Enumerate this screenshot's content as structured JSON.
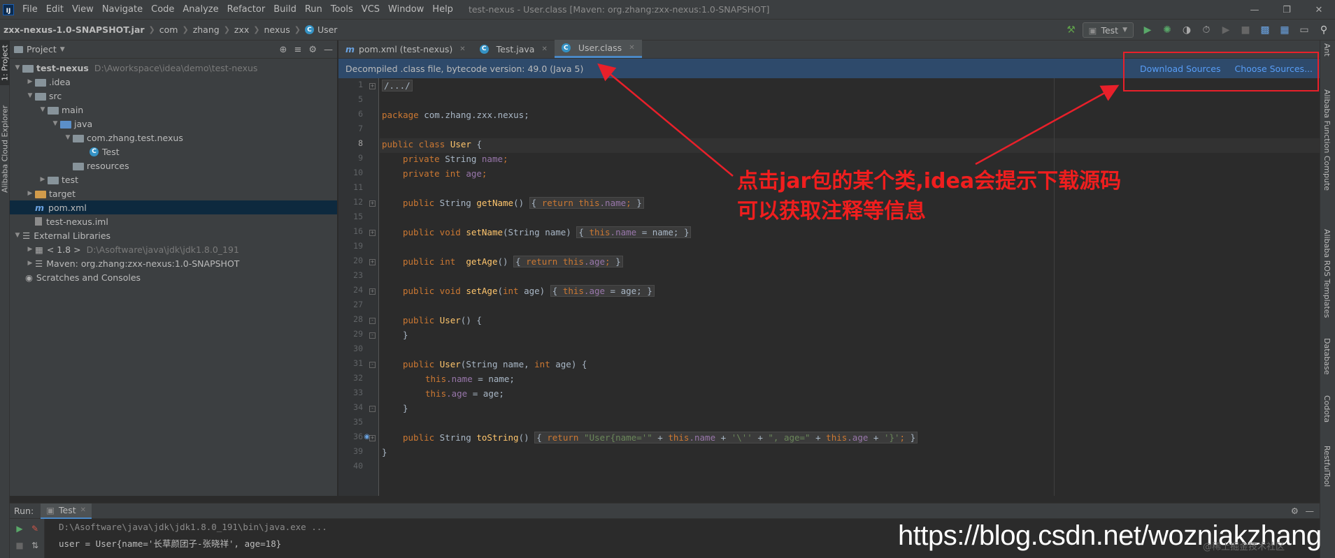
{
  "menubar": {
    "logo": "IJ",
    "items": [
      "File",
      "Edit",
      "View",
      "Navigate",
      "Code",
      "Analyze",
      "Refactor",
      "Build",
      "Run",
      "Tools",
      "VCS",
      "Window",
      "Help"
    ],
    "window_title": "test-nexus - User.class [Maven: org.zhang:zxx-nexus:1.0-SNAPSHOT]"
  },
  "navbar": {
    "breadcrumb": [
      "zxx-nexus-1.0-SNAPSHOT.jar",
      "com",
      "zhang",
      "zxx",
      "nexus",
      "User"
    ],
    "run_config": "Test"
  },
  "left_stripe": {
    "tabs": [
      "1: Project",
      "Alibaba Cloud Explorer"
    ]
  },
  "right_stripe": {
    "tabs": [
      "Ant",
      "Alibaba Function Compute",
      "Alibaba ROS Templates",
      "Database",
      "Codota",
      "RestfulTool"
    ]
  },
  "project_panel": {
    "title": "Project",
    "tree": [
      {
        "label": "test-nexus",
        "path": "D:\\Aworkspace\\idea\\demo\\test-nexus"
      },
      {
        "label": ".idea"
      },
      {
        "label": "src"
      },
      {
        "label": "main"
      },
      {
        "label": "java"
      },
      {
        "label": "com.zhang.test.nexus"
      },
      {
        "label": "Test"
      },
      {
        "label": "resources"
      },
      {
        "label": "test"
      },
      {
        "label": "target"
      },
      {
        "label": "pom.xml"
      },
      {
        "label": "test-nexus.iml"
      },
      {
        "label": "External Libraries"
      },
      {
        "label": "< 1.8 >",
        "path": "D:\\Asoftware\\java\\jdk\\jdk1.8.0_191"
      },
      {
        "label": "Maven: org.zhang:zxx-nexus:1.0-SNAPSHOT"
      },
      {
        "label": "Scratches and Consoles"
      }
    ]
  },
  "editor": {
    "tabs": [
      {
        "label": "pom.xml (test-nexus)",
        "icon": "m"
      },
      {
        "label": "Test.java",
        "icon": "C"
      },
      {
        "label": "User.class",
        "icon": "C"
      }
    ],
    "banner": "Decompiled .class file, bytecode version: 49.0 (Java 5)",
    "download_sources": "Download Sources",
    "choose_sources": "Choose Sources...",
    "line_numbers": [
      "1",
      "5",
      "6",
      "7",
      "8",
      "9",
      "10",
      "11",
      "12",
      "15",
      "16",
      "19",
      "20",
      "23",
      "24",
      "27",
      "28",
      "29",
      "30",
      "31",
      "32",
      "33",
      "34",
      "35",
      "36",
      "39",
      "40"
    ],
    "code": {
      "l1": "/.../",
      "l6a": "package",
      "l6b": " com.zhang.zxx.nexus;",
      "l8a": "public class",
      "l8b": " User",
      "l8c": " {",
      "private": "private",
      "string_type": " String ",
      "int_type": "int",
      "name": "name",
      "age": "age",
      "semi": ";",
      "public": "public",
      "ret_string": " String ",
      "ret_void": " void ",
      "ret_int": " int ",
      "getName": "getName",
      "setName": "setName",
      "getAge": "getAge",
      "setAge": "setAge",
      "user_ctor": "User",
      "toString": "toString",
      "paren_empty": "()",
      "fold_return": "return",
      "this": "this",
      "dot_name": ".name",
      "dot_age": ".age",
      "param_string_name": "(String name)",
      "param_int": "(",
      "param_age": " age)",
      "assign_name": " = name;",
      "assign_age": " = age;",
      "ctor_params_a": "(String name, ",
      "brace_open": " {",
      "brace_close": "}",
      "str1": "\"User{name='\"",
      "plus": " + ",
      "str2": "'\\''",
      "str3": "\", age=\"",
      "str4": "'}'",
      "fold_open": "{",
      "fold_close": "}"
    }
  },
  "run_panel": {
    "label": "Run:",
    "tab": "Test",
    "line1": "D:\\Asoftware\\java\\jdk\\jdk1.8.0_191\\bin\\java.exe ...",
    "line2": "user = User{name='长草颜团子-张晓祥', age=18}"
  },
  "annotation": {
    "line1": "点击jar包的某个类,idea会提示下载源码",
    "line2": "可以获取注释等信息",
    "color": "#e8202a"
  },
  "watermark": {
    "url": "https://blog.csdn.net/wozniakzhang",
    "small": "@稀土掘金技术社区"
  }
}
